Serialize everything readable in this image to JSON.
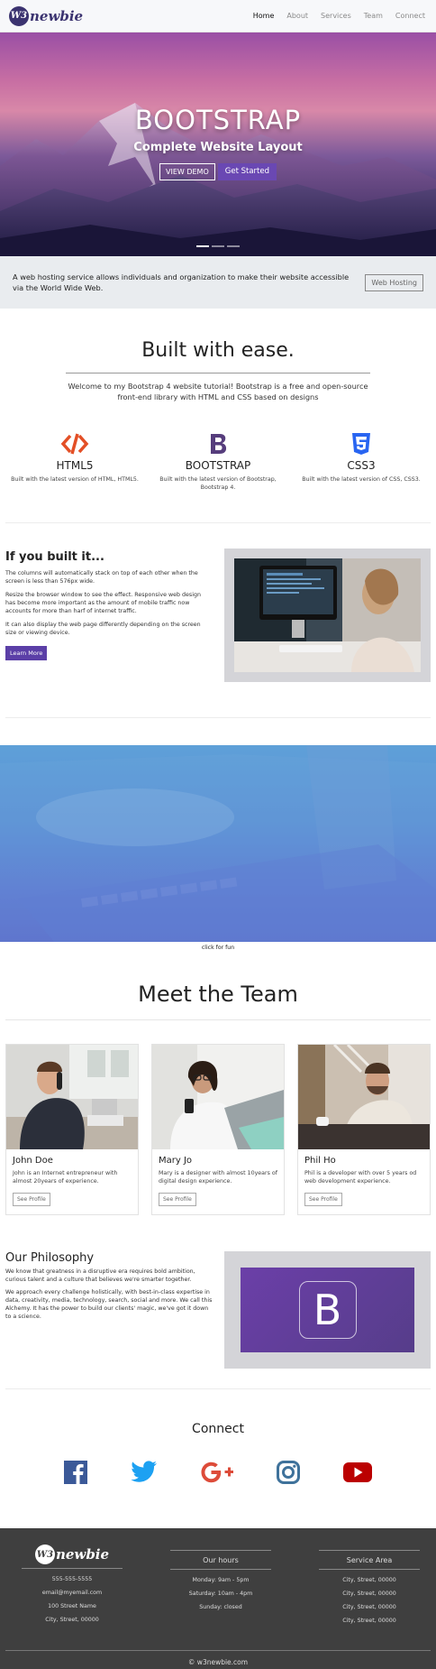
{
  "nav": {
    "logo_badge": "W3",
    "logo_text": "newbie",
    "links": [
      "Home",
      "About",
      "Services",
      "Team",
      "Connect"
    ],
    "active": "Home"
  },
  "hero": {
    "title": "BOOTSTRAP",
    "subtitle": "Complete Website Layout",
    "demo_button": "VIEW DEMO",
    "start_button": "Get Started",
    "slides": 3,
    "active_slide": 1
  },
  "jumbotron": {
    "text": "A web hosting service allows individuals and organization to make their website accessible via the World Wide Web.",
    "button": "Web Hosting"
  },
  "welcome": {
    "title": "Built with ease.",
    "text": "Welcome to my Bootstrap 4 website tutorial! Bootstrap is a free and open-source front-end library with HTML and CSS based on designs",
    "techs": [
      {
        "name": "HTML5",
        "desc": "Built with the latest version of HTML, HTML5.",
        "icon": "html5-icon",
        "color": "#e34f26"
      },
      {
        "name": "BOOTSTRAP",
        "desc": "Built with the latest version of Bootstrap, Bootstrap 4.",
        "icon": "bootstrap-icon",
        "color": "#563d7c"
      },
      {
        "name": "CSS3",
        "desc": "Built with the latest version of CSS, CSS3.",
        "icon": "css3-icon",
        "color": "#2965f1"
      }
    ]
  },
  "built": {
    "title": "If you built it...",
    "paragraphs": [
      "The columns will automatically stack on top of each other when the screen is less than 576px wide.",
      "Resize the browser window to see the effect. Responsive web design has become more important as the amount of mobile traffic now accounts for more than harf of internet traffic.",
      "It can also display the web page differently depending on the screen size or viewing device."
    ],
    "button": "Learn More"
  },
  "parallax": {
    "caption": "click for fun"
  },
  "team": {
    "title": "Meet the Team",
    "members": [
      {
        "name": "John Doe",
        "desc": "John is an Internet entrepreneur with almost 20years of experience.",
        "button": "See Profile"
      },
      {
        "name": "Mary Jo",
        "desc": "Mary is a designer with almost 10years of digital design experience.",
        "button": "See Profile"
      },
      {
        "name": "Phil Ho",
        "desc": "Phil is a developer with over 5 years od web development experience.",
        "button": "See Profile"
      }
    ]
  },
  "philosophy": {
    "title": "Our Philosophy",
    "paragraphs": [
      "We know that greatness in a disruptive era requires bold ambition, curious talent and a culture that believes we're smarter together.",
      "We approach every challenge holistically, with best-in-class expertise in data, creativity, media, technology, search, social and more. We call this Alchemy. It has the power to build our clients' magic, we've got it down to a science."
    ],
    "logo_letter": "B"
  },
  "connect": {
    "title": "Connect",
    "icons": [
      "facebook-icon",
      "twitter-icon",
      "google-plus-icon",
      "instagram-icon",
      "youtube-icon"
    ]
  },
  "footer": {
    "contact": [
      "555-555-5555",
      "email@myemail.com",
      "100 Street Name",
      "City, Street, 00000"
    ],
    "hours_title": "Our hours",
    "hours": [
      "Monday: 9am - 5pm",
      "Saturday: 10am - 4pm",
      "Sunday: closed"
    ],
    "area_title": "Service Area",
    "areas": [
      "City, Street, 00000",
      "City, Street, 00000",
      "City, Street, 00000",
      "City, Street, 00000"
    ],
    "copyright": "© w3newbie.com"
  }
}
